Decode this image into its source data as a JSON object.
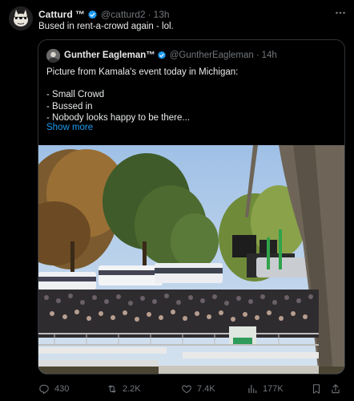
{
  "tweet": {
    "author_name": "Catturd ™",
    "handle": "@catturd2",
    "separator": "·",
    "time": "13h",
    "text": "Bused in rent-a-crowd again - lol.",
    "more_icon": "ellipsis-icon"
  },
  "quote": {
    "author_name": "Gunther Eagleman™",
    "handle": "@GuntherEagleman",
    "separator": "·",
    "time": "14h",
    "lines": [
      "Picture from Kamala's event today in Michigan:",
      "",
      "- Small Crowd",
      "- Bussed in",
      "- Nobody looks happy to be there..."
    ],
    "show_more": "Show more"
  },
  "actions": {
    "replies": "430",
    "reposts": "2.2K",
    "likes": "7.4K",
    "views": "177K"
  },
  "colors": {
    "background": "#000000",
    "text": "#e7e9ea",
    "muted": "#71767b",
    "accent": "#1d9bf0",
    "border": "#2f3336"
  }
}
